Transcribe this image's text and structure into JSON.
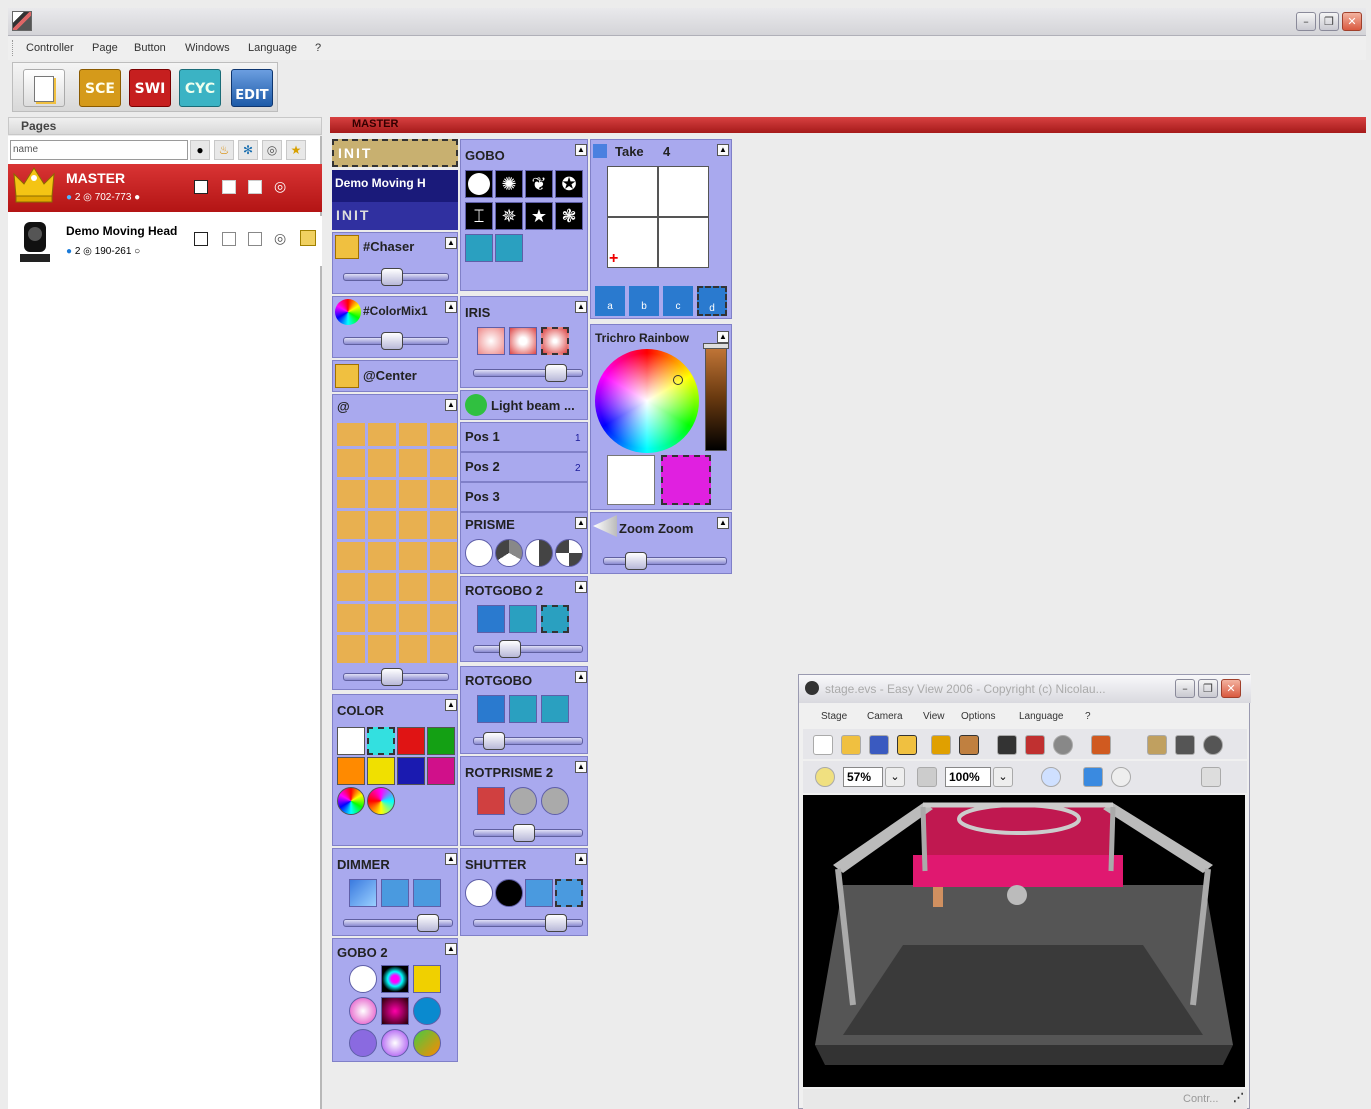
{
  "window": {
    "min_glyph": "–",
    "max_glyph": "❐",
    "close_glyph": "✕"
  },
  "menu": [
    "Controller",
    "Page",
    "Button",
    "Windows",
    "Language",
    "?"
  ],
  "toolbar": {
    "buttons": [
      {
        "label": "",
        "icon": "new-page-icon"
      },
      {
        "label": "SCE",
        "color": "#d59a1a"
      },
      {
        "label": "SWI",
        "color": "#c61f1f"
      },
      {
        "label": "CYC",
        "color": "#3bb3c4"
      },
      {
        "label": "EDIT",
        "color": "#1d5aa8"
      }
    ]
  },
  "pages": {
    "header": "Pages",
    "search_placeholder": "name",
    "tools": [
      "eye-icon",
      "flame-icon",
      "snowflake-icon",
      "target-icon",
      "star-icon"
    ],
    "items": [
      {
        "name": "MASTER",
        "count": "2",
        "range": "702-773",
        "selected": true
      },
      {
        "name": "Demo Moving Head",
        "count": "2",
        "range": "190-261",
        "selected": false
      }
    ]
  },
  "master_label": "MASTER",
  "controls": {
    "init_button": "INIT",
    "demo_moving": "Demo Moving H",
    "init_button_2": "INIT",
    "chaser": "#Chaser",
    "colormix": "#ColorMix1",
    "center": "@Center",
    "at_panel": "@",
    "color": "COLOR",
    "dimmer": "DIMMER",
    "gobo2": "GOBO 2",
    "gobo": "GOBO",
    "iris": "IRIS",
    "light_beam": "Light beam ...",
    "positions": [
      {
        "label": "Pos 1",
        "num": "1"
      },
      {
        "label": "Pos 2",
        "num": "2"
      },
      {
        "label": "Pos 3",
        "num": ""
      }
    ],
    "prisme": "PRISME",
    "rotgobo2": "ROTGOBO 2",
    "rotgobo": "ROTGOBO",
    "rotprisme2": "ROTPRISME 2",
    "shutter": "SHUTTER",
    "take": "Take",
    "take_num": "4",
    "take_tabs": [
      "a",
      "b",
      "c",
      "d"
    ],
    "trichro": "Trichro Rainbow",
    "zoom": "Zoom Zoom",
    "color_swatches": [
      "#ffffff",
      "#33e0e0",
      "#e01414",
      "#14a014",
      "#ff8a00",
      "#f0e000",
      "#1a1ab0",
      "#d0108a"
    ]
  },
  "easyview": {
    "title": "stage.evs - Easy View 2006 - Copyright (c) Nicolau...",
    "menu": [
      "Stage",
      "Camera",
      "View",
      "Options",
      "Language",
      "?"
    ],
    "zoom1": "57%",
    "zoom2": "100%",
    "status": "Contr..."
  }
}
